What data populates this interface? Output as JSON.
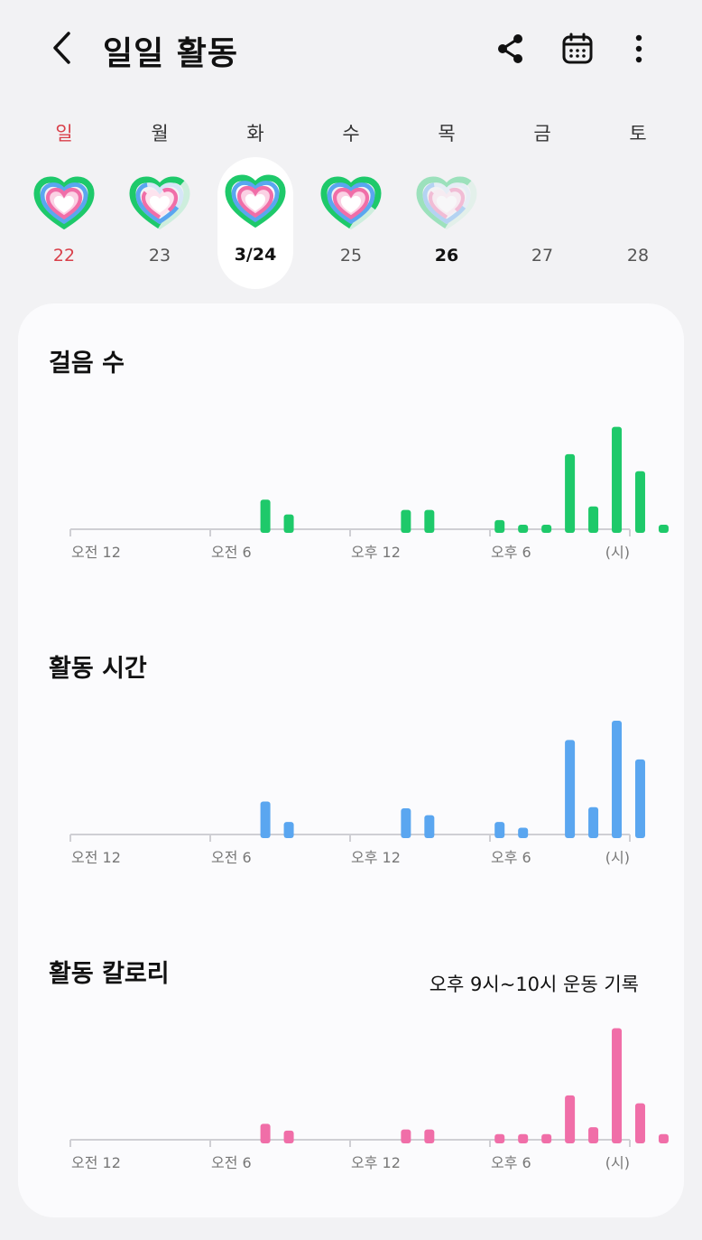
{
  "header": {
    "title": "일일 활동",
    "back_icon": "chevron-left-icon",
    "actions": [
      "share-icon",
      "calendar-icon",
      "more-vertical-icon"
    ]
  },
  "week": {
    "days": [
      {
        "dow": "일",
        "date": "22",
        "state": "sunday",
        "ring": "full"
      },
      {
        "dow": "월",
        "date": "23",
        "state": "normal",
        "ring": "partial"
      },
      {
        "dow": "화",
        "date": "3/24",
        "state": "selected",
        "ring": "full"
      },
      {
        "dow": "수",
        "date": "25",
        "state": "normal",
        "ring": "near-full"
      },
      {
        "dow": "목",
        "date": "26",
        "state": "today",
        "ring": "faded"
      },
      {
        "dow": "금",
        "date": "27",
        "state": "normal",
        "ring": "none"
      },
      {
        "dow": "토",
        "date": "28",
        "state": "normal",
        "ring": "none"
      }
    ]
  },
  "colors": {
    "steps": "#1ec96a",
    "active_time": "#5aa6f0",
    "calories": "#f06ea8",
    "sunday": "#d9404a",
    "background": "#f2f2f4",
    "card": "#fbfbfd"
  },
  "sections": {
    "steps_title": "걸음 수",
    "time_title": "활동 시간",
    "cal_title": "활동 칼로리",
    "cal_note": "오후 9시~10시 운동 기록"
  },
  "chart_data": [
    {
      "type": "bar",
      "title": "걸음 수",
      "x": [
        0,
        1,
        2,
        3,
        4,
        5,
        6,
        7,
        8,
        9,
        10,
        11,
        12,
        13,
        14,
        15,
        16,
        17,
        18,
        19,
        20,
        21,
        22,
        23
      ],
      "values": [
        0,
        0,
        0,
        0,
        0,
        0,
        0,
        0,
        26,
        13,
        0,
        0,
        0,
        0,
        17,
        17,
        0,
        0,
        8,
        4,
        4,
        66,
        20,
        90,
        51,
        4
      ],
      "x_tick_labels": [
        "오전 12",
        "오전 6",
        "오후 12",
        "오후 6",
        "(시)"
      ],
      "ylim": [
        0,
        100
      ],
      "color": "#1ec96a",
      "grid": false
    },
    {
      "type": "bar",
      "title": "활동 시간",
      "x": [
        0,
        1,
        2,
        3,
        4,
        5,
        6,
        7,
        8,
        9,
        10,
        11,
        12,
        13,
        14,
        15,
        16,
        17,
        18,
        19,
        20,
        21,
        22,
        23
      ],
      "values": [
        0,
        0,
        0,
        0,
        0,
        0,
        0,
        0,
        29,
        11,
        0,
        0,
        0,
        0,
        23,
        17,
        0,
        0,
        11,
        6,
        0,
        83,
        24,
        100,
        66,
        0
      ],
      "x_tick_labels": [
        "오전 12",
        "오전 6",
        "오후 12",
        "오후 6",
        "(시)"
      ],
      "ylim": [
        0,
        100
      ],
      "color": "#5aa6f0",
      "grid": false
    },
    {
      "type": "bar",
      "title": "활동 칼로리",
      "x": [
        0,
        1,
        2,
        3,
        4,
        5,
        6,
        7,
        8,
        9,
        10,
        11,
        12,
        13,
        14,
        15,
        16,
        17,
        18,
        19,
        20,
        21,
        22,
        23
      ],
      "values": [
        0,
        0,
        0,
        0,
        0,
        0,
        0,
        0,
        14,
        8,
        0,
        0,
        0,
        0,
        9,
        9,
        0,
        0,
        5,
        5,
        5,
        39,
        11,
        98,
        32,
        5
      ],
      "x_tick_labels": [
        "오전 12",
        "오전 6",
        "오후 12",
        "오후 6",
        "(시)"
      ],
      "ylim": [
        0,
        100
      ],
      "color": "#f06ea8",
      "grid": false
    }
  ]
}
